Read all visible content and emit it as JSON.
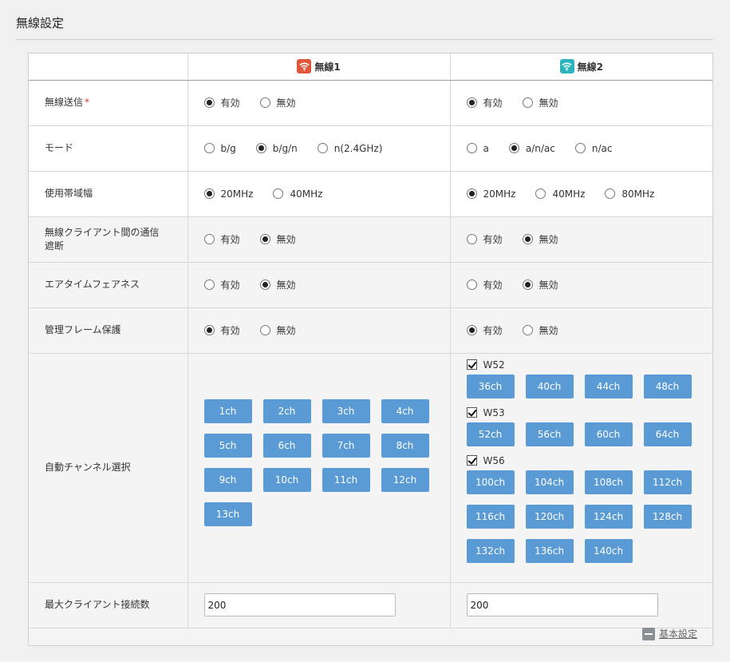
{
  "page_title": "無線設定",
  "radio1": {
    "label": "無線1",
    "color": "#e05638"
  },
  "radio2": {
    "label": "無線2",
    "color": "#2bb3c0"
  },
  "rows": {
    "tx": {
      "label": "無線送信",
      "required_mark": "*",
      "r1": [
        {
          "label": "有効",
          "checked": true
        },
        {
          "label": "無効",
          "checked": false
        }
      ],
      "r2": [
        {
          "label": "有効",
          "checked": true
        },
        {
          "label": "無効",
          "checked": false
        }
      ]
    },
    "mode": {
      "label": "モード",
      "r1": [
        {
          "label": "b/g",
          "checked": false
        },
        {
          "label": "b/g/n",
          "checked": true
        },
        {
          "label": "n(2.4GHz)",
          "checked": false
        }
      ],
      "r2": [
        {
          "label": "a",
          "checked": false
        },
        {
          "label": "a/n/ac",
          "checked": true
        },
        {
          "label": "n/ac",
          "checked": false
        }
      ]
    },
    "bw": {
      "label": "使用帯域幅",
      "r1": [
        {
          "label": "20MHz",
          "checked": true
        },
        {
          "label": "40MHz",
          "checked": false
        }
      ],
      "r2": [
        {
          "label": "20MHz",
          "checked": true
        },
        {
          "label": "40MHz",
          "checked": false
        },
        {
          "label": "80MHz",
          "checked": false
        }
      ]
    },
    "isolation": {
      "label_line1": "無線クライアント間の通信",
      "label_line2": "遮断",
      "r1": [
        {
          "label": "有効",
          "checked": false
        },
        {
          "label": "無効",
          "checked": true
        }
      ],
      "r2": [
        {
          "label": "有効",
          "checked": false
        },
        {
          "label": "無効",
          "checked": true
        }
      ]
    },
    "airtime": {
      "label": "エアタイムフェアネス",
      "r1": [
        {
          "label": "有効",
          "checked": false
        },
        {
          "label": "無効",
          "checked": true
        }
      ],
      "r2": [
        {
          "label": "有効",
          "checked": false
        },
        {
          "label": "無効",
          "checked": true
        }
      ]
    },
    "pmf": {
      "label": "管理フレーム保護",
      "r1": [
        {
          "label": "有効",
          "checked": true
        },
        {
          "label": "無効",
          "checked": false
        }
      ],
      "r2": [
        {
          "label": "有効",
          "checked": true
        },
        {
          "label": "無効",
          "checked": false
        }
      ]
    },
    "auto_channel": {
      "label": "自動チャンネル選択",
      "r1_channels": [
        "1ch",
        "2ch",
        "3ch",
        "4ch",
        "5ch",
        "6ch",
        "7ch",
        "8ch",
        "9ch",
        "10ch",
        "11ch",
        "12ch",
        "13ch"
      ],
      "r2_bands": [
        {
          "name": "W52",
          "checked": true,
          "channels": [
            "36ch",
            "40ch",
            "44ch",
            "48ch"
          ]
        },
        {
          "name": "W53",
          "checked": true,
          "channels": [
            "52ch",
            "56ch",
            "60ch",
            "64ch"
          ]
        },
        {
          "name": "W56",
          "checked": true,
          "channels": [
            "100ch",
            "104ch",
            "108ch",
            "112ch",
            "116ch",
            "120ch",
            "124ch",
            "128ch",
            "132ch",
            "136ch",
            "140ch"
          ]
        }
      ]
    },
    "max_clients": {
      "label": "最大クライアント接続数",
      "r1_value": "200",
      "r2_value": "200"
    }
  },
  "footer": {
    "link_label": "基本設定"
  }
}
